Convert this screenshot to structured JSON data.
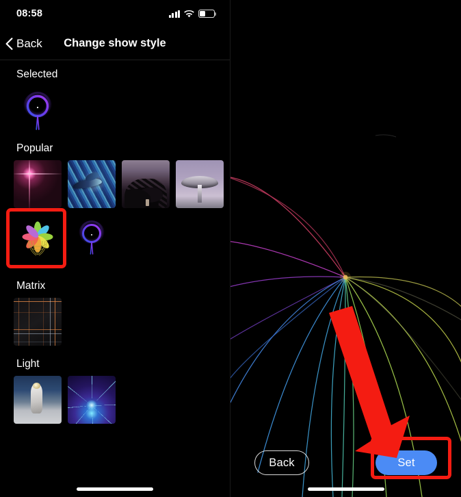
{
  "status_bar": {
    "time": "08:58",
    "cell_icon": "cellular-signal-icon",
    "wifi_icon": "wifi-icon",
    "battery_icon": "battery-icon",
    "battery_level_pct": 38
  },
  "left_screen": {
    "nav": {
      "back_icon": "chevron-left-icon",
      "back_label": "Back",
      "title": "Change show style"
    },
    "sections": [
      {
        "title": "Selected",
        "items": [
          {
            "name": "purple-ring-style",
            "kind": "ring",
            "highlighted": false
          }
        ]
      },
      {
        "title": "Popular",
        "items": [
          {
            "name": "pink-flare-style",
            "kind": "flare",
            "highlighted": false
          },
          {
            "name": "blue-dolphin-style",
            "kind": "dolphin",
            "highlighted": false
          },
          {
            "name": "dark-tree-style",
            "kind": "tree",
            "highlighted": false
          },
          {
            "name": "satellite-dish-style",
            "kind": "dish",
            "highlighted": false
          },
          {
            "name": "rainbow-flower-style",
            "kind": "flower",
            "highlighted": true
          },
          {
            "name": "purple-ring-style",
            "kind": "ring",
            "highlighted": false
          }
        ]
      },
      {
        "title": "Matrix",
        "items": [
          {
            "name": "matrix-grid-style",
            "kind": "matrix",
            "highlighted": false
          }
        ]
      },
      {
        "title": "Light",
        "items": [
          {
            "name": "astronaut-style",
            "kind": "astro",
            "highlighted": false
          },
          {
            "name": "blue-fractal-style",
            "kind": "fractal",
            "highlighted": false
          }
        ]
      }
    ]
  },
  "right_screen": {
    "preview_name": "rainbow-flower-preview",
    "annotation": {
      "arrow_icon": "red-arrow-icon",
      "arrow_color": "#f41c12",
      "highlight_color": "#f41c12",
      "highlight_target": "set-button"
    },
    "buttons": {
      "back_label": "Back",
      "set_label": "Set"
    }
  },
  "colors": {
    "accent_blue": "#4b8bf5",
    "annotation_red": "#f41c12",
    "background": "#000000",
    "text_primary": "#ffffff",
    "ring_purple": "#8b3bf0",
    "ring_blue": "#4a5cf0"
  },
  "home_indicator": "home-indicator"
}
